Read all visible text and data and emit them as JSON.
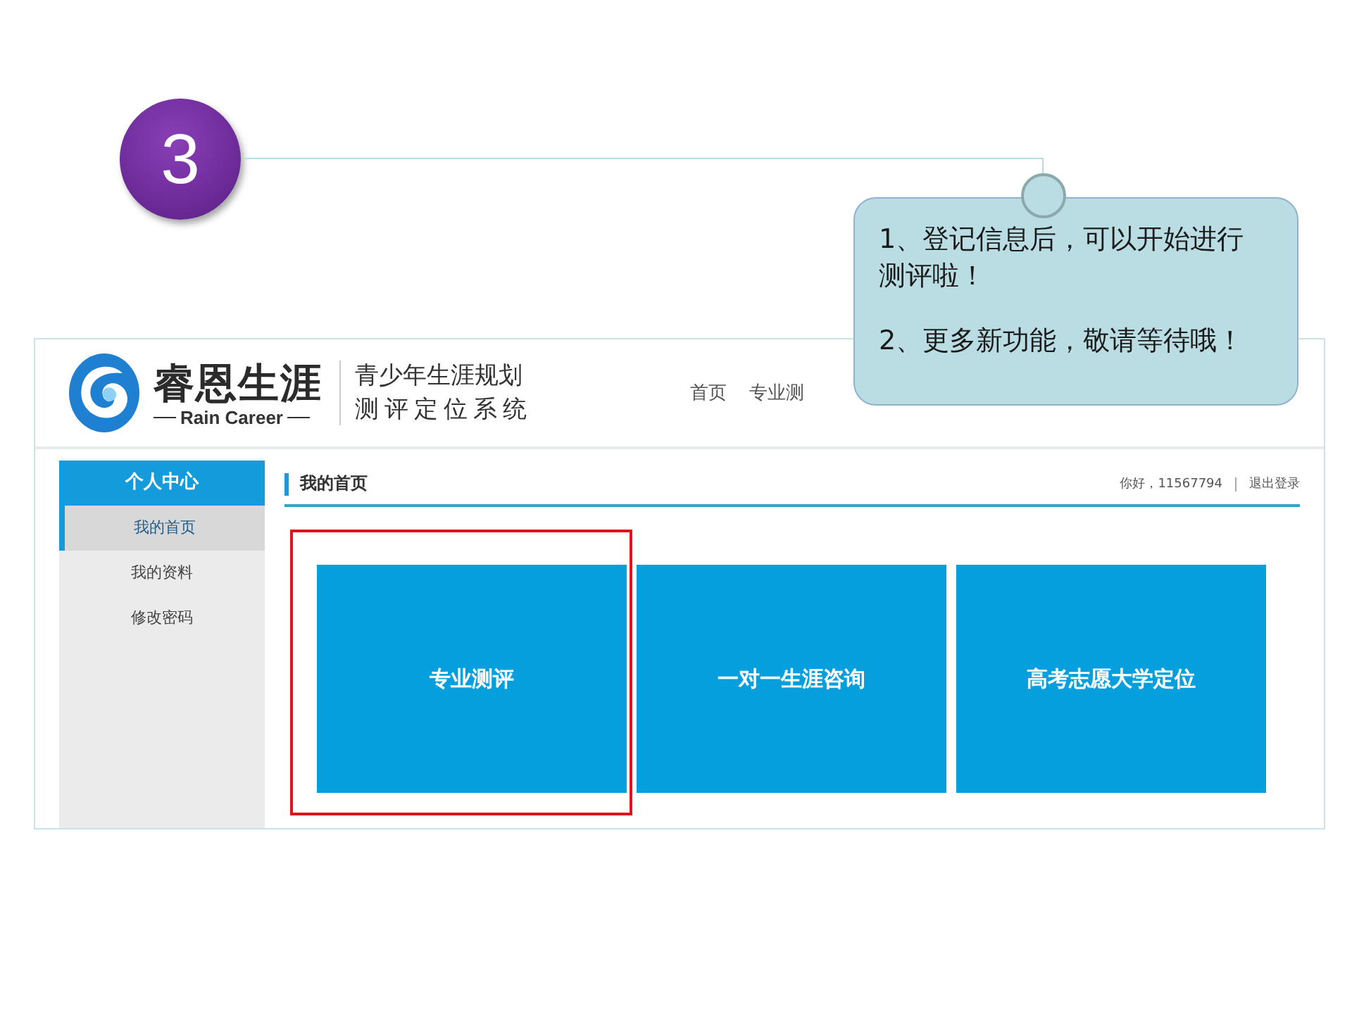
{
  "step": {
    "number": "3"
  },
  "callout": {
    "paragraphs": [
      "1、登记信息后，可以开始进行测评啦！",
      "2、更多新功能，敬请等待哦！"
    ]
  },
  "site": {
    "logo": {
      "name": "睿恩生涯",
      "tagline": "Rain Career"
    },
    "slogan": [
      "青少年生涯规划",
      "测评定位系统"
    ],
    "nav": [
      {
        "label": "首页"
      },
      {
        "label": "专业测"
      }
    ]
  },
  "sidebar": {
    "title": "个人中心",
    "items": [
      {
        "label": "我的首页",
        "selected": true
      },
      {
        "label": "我的资料",
        "selected": false
      },
      {
        "label": "修改密码",
        "selected": false
      }
    ]
  },
  "main": {
    "title": "我的首页",
    "greeting": "你好，11567794",
    "logout": "退出登录",
    "tiles": [
      {
        "label": "专业测评",
        "highlighted": true
      },
      {
        "label": "一对一生涯咨询",
        "highlighted": false
      },
      {
        "label": "高考志愿大学定位",
        "highlighted": false
      }
    ]
  }
}
